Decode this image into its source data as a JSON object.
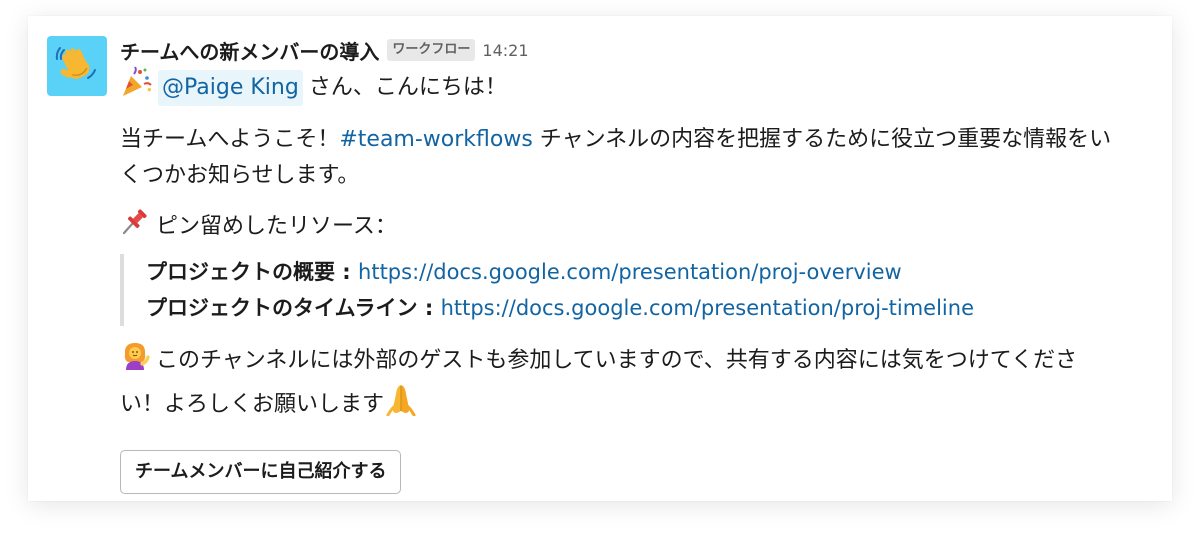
{
  "message": {
    "sender_name": "チームへの新メンバーの導入",
    "workflow_badge": "ワークフロー",
    "timestamp": "14:21",
    "avatar_icon": "waving-hand-icon",
    "greeting": {
      "emoji_icon": "party-popper-icon",
      "mention": "@Paige King",
      "text": "さん、こんにちは！"
    },
    "intro": {
      "before": "当チームへようこそ！",
      "channel": "#team-workflows",
      "after": " チャンネルの内容を把握するために役立つ重要な情報をいくつかお知らせします。"
    },
    "pinned": {
      "emoji_icon": "pushpin-icon",
      "label": "ピン留めしたリソース："
    },
    "resources": [
      {
        "label": "プロジェクトの概要",
        "sep": " : ",
        "url": "https://docs.google.com/presentation/proj-overview"
      },
      {
        "label": "プロジェクトのタイムライン",
        "sep": " : ",
        "url": "https://docs.google.com/presentation/proj-timeline"
      }
    ],
    "guest_notice": {
      "emoji_icon": "person-tipping-hand-icon",
      "text": "このチャンネルには外部のゲストも参加していますので、共有する内容には気をつけてください！よろしくお願いします",
      "end_emoji_icon": "folded-hands-icon"
    },
    "action_button": "チームメンバーに自己紹介する"
  },
  "colors": {
    "link": "#1264a3",
    "avatar_bg": "#5ad1f6",
    "mention_bg": "#e8f5fa",
    "badge_bg": "#e8e8e8",
    "quote_bar": "#dddddd"
  }
}
